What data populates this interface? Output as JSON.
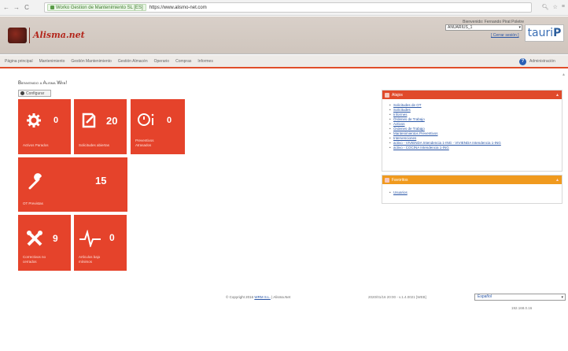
{
  "browser": {
    "back": "←",
    "forward": "→",
    "reload": "C",
    "site_identity": "Worko Gestion de Mantenimiento SL [ES]",
    "url": "https://www.alismo-net.com",
    "icons": [
      "zoom-icon",
      "star-icon",
      "menu-icon"
    ]
  },
  "header": {
    "logo_text": "Alisma.net",
    "user_greeting": "Bienvenido: Fernando Pirat Poletre",
    "user_select": "ANUARIUS_1",
    "logout": "[ Cerrar sesión ]",
    "brand": "tauri",
    "brand_p": "P"
  },
  "menu": {
    "items": [
      "Página principal",
      "Mantenimiento",
      "Gestión Mantenimiento",
      "Gestión Almacén",
      "Operario",
      "Compras",
      "Informes"
    ],
    "admin": "Administración"
  },
  "welcome": "Bienvenido a Alisma Web!",
  "config_button": "Configurar",
  "tiles": [
    {
      "label": "Activos Parados",
      "count": "0",
      "icon": "gear-alert-icon"
    },
    {
      "label": "Solicitudes abiertas",
      "count": "20",
      "icon": "document-edit-icon"
    },
    {
      "label": "Preventivos Atrasados",
      "count": "0",
      "icon": "clock-info-icon"
    },
    {
      "label": "OT Previstas",
      "count": "15",
      "icon": "wrench-icon"
    },
    {
      "label": "Correctivos no cerrados",
      "count": "9",
      "icon": "tools-cross-icon"
    },
    {
      "label": "Artículos bajo mínimos",
      "count": "0",
      "icon": "pulse-icon"
    }
  ],
  "panels": {
    "shortcuts": {
      "title": "Atajos",
      "items": [
        "Solicitudes de OT",
        "Solicitudes",
        "Informes",
        "Órdenes de Trabajo",
        "Activos",
        "Órdenes de Trabajo",
        "Mantenimientos Preventivos",
        "Intervenciones",
        "activo - VIVIENDA Intendencia 1-ING - VIVIENDA Intendencia 1-ING",
        "activo - COCINA Intendencia 1-ING"
      ]
    },
    "favorites": {
      "title": "Favoritos",
      "items": [
        "Usuarios"
      ]
    }
  },
  "footer": {
    "copyright_prefix": "© Copyright 2016",
    "company": "WRM S.L.",
    "copyright_suffix": "| Alisma.Net",
    "version": "2020/01/16 20:00 - v.1.4.0021 [WEB]",
    "language": "Español",
    "ip": "192.168.0.16"
  },
  "colors": {
    "accent": "#e5432b",
    "header_bg": "#d6cdc6",
    "link": "#2a56a6",
    "brand_blue": "#3b6fb5"
  }
}
